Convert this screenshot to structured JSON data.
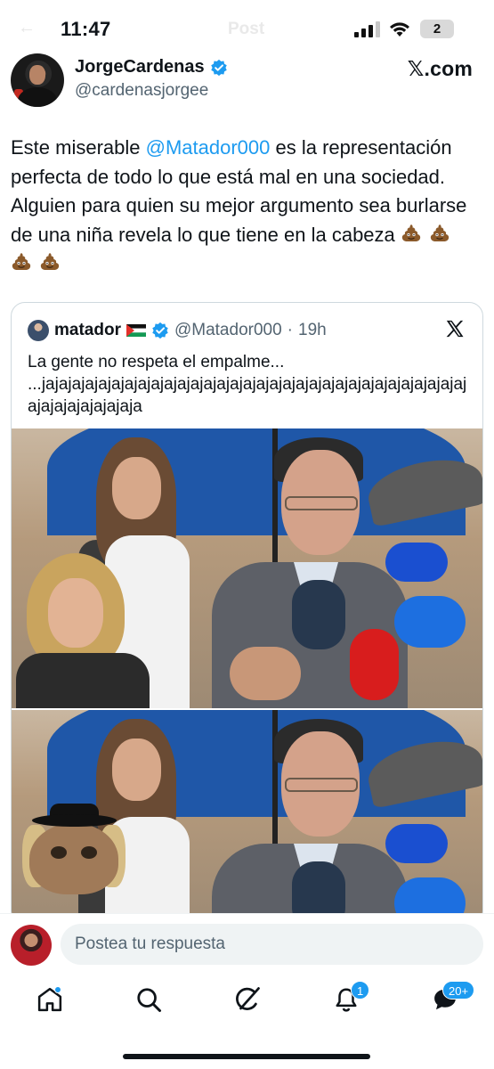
{
  "status_bar": {
    "time": "11:47",
    "battery": "2",
    "behind_back": "←",
    "behind_title": "Post"
  },
  "author": {
    "name": "JorgeCardenas",
    "handle": "@cardenasjorgee",
    "source": "𝕏.com",
    "verified": true
  },
  "tweet": {
    "text_before": "Este miserable ",
    "mention": "@Matador000",
    "text_after": " es la representación perfecta de todo lo que está mal en una sociedad. Alguien para quien su mejor argumento sea burlarse de una niña revela lo que tiene en la cabeza",
    "emoji_count": 4,
    "emoji_icon": "pile-of-poo-icon"
  },
  "quote": {
    "name": "matador",
    "flag_icon": "palestine-flag-icon",
    "verified": true,
    "handle": "@Matador000",
    "separator": "·",
    "time": "19h",
    "text": "La gente no respeta el empalme...\n...jajajajajajajajajajajajajajajajajajajajajajajajajajajajajajajajajajajajajajajajaja",
    "media": [
      "news-interview-photo",
      "news-interview-photo-edited"
    ]
  },
  "reply": {
    "placeholder": "Postea tu respuesta"
  },
  "tabs": [
    {
      "name": "home",
      "icon": "home-icon",
      "dot": true
    },
    {
      "name": "search",
      "icon": "search-icon"
    },
    {
      "name": "grok",
      "icon": "grok-icon"
    },
    {
      "name": "notifications",
      "icon": "bell-icon",
      "badge": "1"
    },
    {
      "name": "messages",
      "icon": "messages-icon",
      "badge": "20+"
    }
  ],
  "colors": {
    "accent": "#1d9bf0",
    "text": "#0f1419",
    "secondary": "#536471",
    "border": "#cfd9de"
  }
}
